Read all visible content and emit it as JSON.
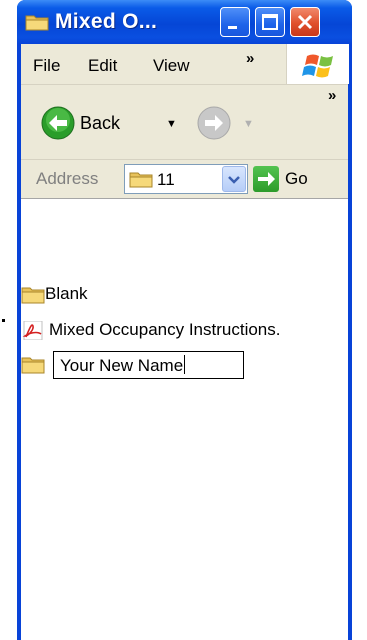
{
  "window": {
    "title": "Mixed O...",
    "controls": [
      "minimize",
      "maximize",
      "close"
    ]
  },
  "menubar": {
    "items": [
      "File",
      "Edit",
      "View"
    ],
    "overflow": "»"
  },
  "toolbar": {
    "back_label": "Back",
    "overflow": "»"
  },
  "addressbar": {
    "label": "Address",
    "value": "11",
    "go_label": "Go"
  },
  "files": [
    {
      "name": "Blank",
      "icon": "folder-icon"
    },
    {
      "name": "Mixed Occupancy Instructions.",
      "icon": "pdf-icon"
    },
    {
      "name": "",
      "icon": "folder-icon"
    }
  ],
  "rename": {
    "value": "Your New Name"
  },
  "colors": {
    "titlebar": "#0546d6",
    "chrome": "#ece9d8",
    "close": "#e0502c",
    "go": "#2d9b2b"
  }
}
